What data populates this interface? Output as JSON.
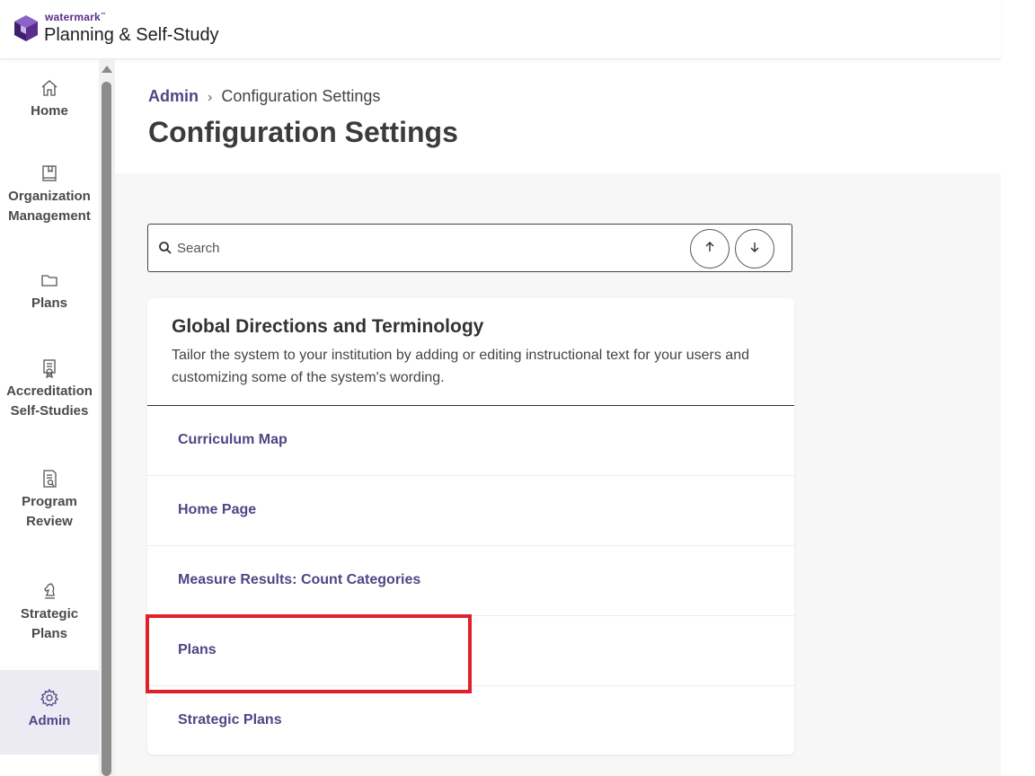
{
  "brand": {
    "small": "watermark",
    "tm": "™",
    "product": "Planning & Self-Study"
  },
  "sidebar": {
    "items": [
      {
        "label_lines": [
          "Home"
        ],
        "icon": "home-icon"
      },
      {
        "label_lines": [
          "Organization",
          "Management"
        ],
        "icon": "book-icon"
      },
      {
        "label_lines": [
          "Plans"
        ],
        "icon": "folder-icon"
      },
      {
        "label_lines": [
          "Accreditation",
          "Self-Studies"
        ],
        "icon": "certificate-icon"
      },
      {
        "label_lines": [
          "Program",
          "Review"
        ],
        "icon": "document-search-icon"
      },
      {
        "label_lines": [
          "Strategic",
          "Plans"
        ],
        "icon": "chess-knight-icon"
      },
      {
        "label_lines": [
          "Admin"
        ],
        "icon": "gear-icon",
        "active": true
      }
    ]
  },
  "breadcrumb": {
    "parent": "Admin",
    "separator": "›",
    "current": "Configuration Settings"
  },
  "page_title": "Configuration Settings",
  "search": {
    "placeholder": "Search",
    "value": ""
  },
  "card": {
    "title": "Global Directions and Terminology",
    "description": "Tailor the system to your institution by adding or editing instructional text for your users and customizing some of the system's wording.",
    "rows": [
      "Curriculum Map",
      "Home Page",
      "Measure Results: Count Categories",
      "Plans",
      "Strategic Plans"
    ]
  },
  "colors": {
    "accent": "#4c4785",
    "brand": "#5b2d8e",
    "highlight": "#e0202b"
  }
}
